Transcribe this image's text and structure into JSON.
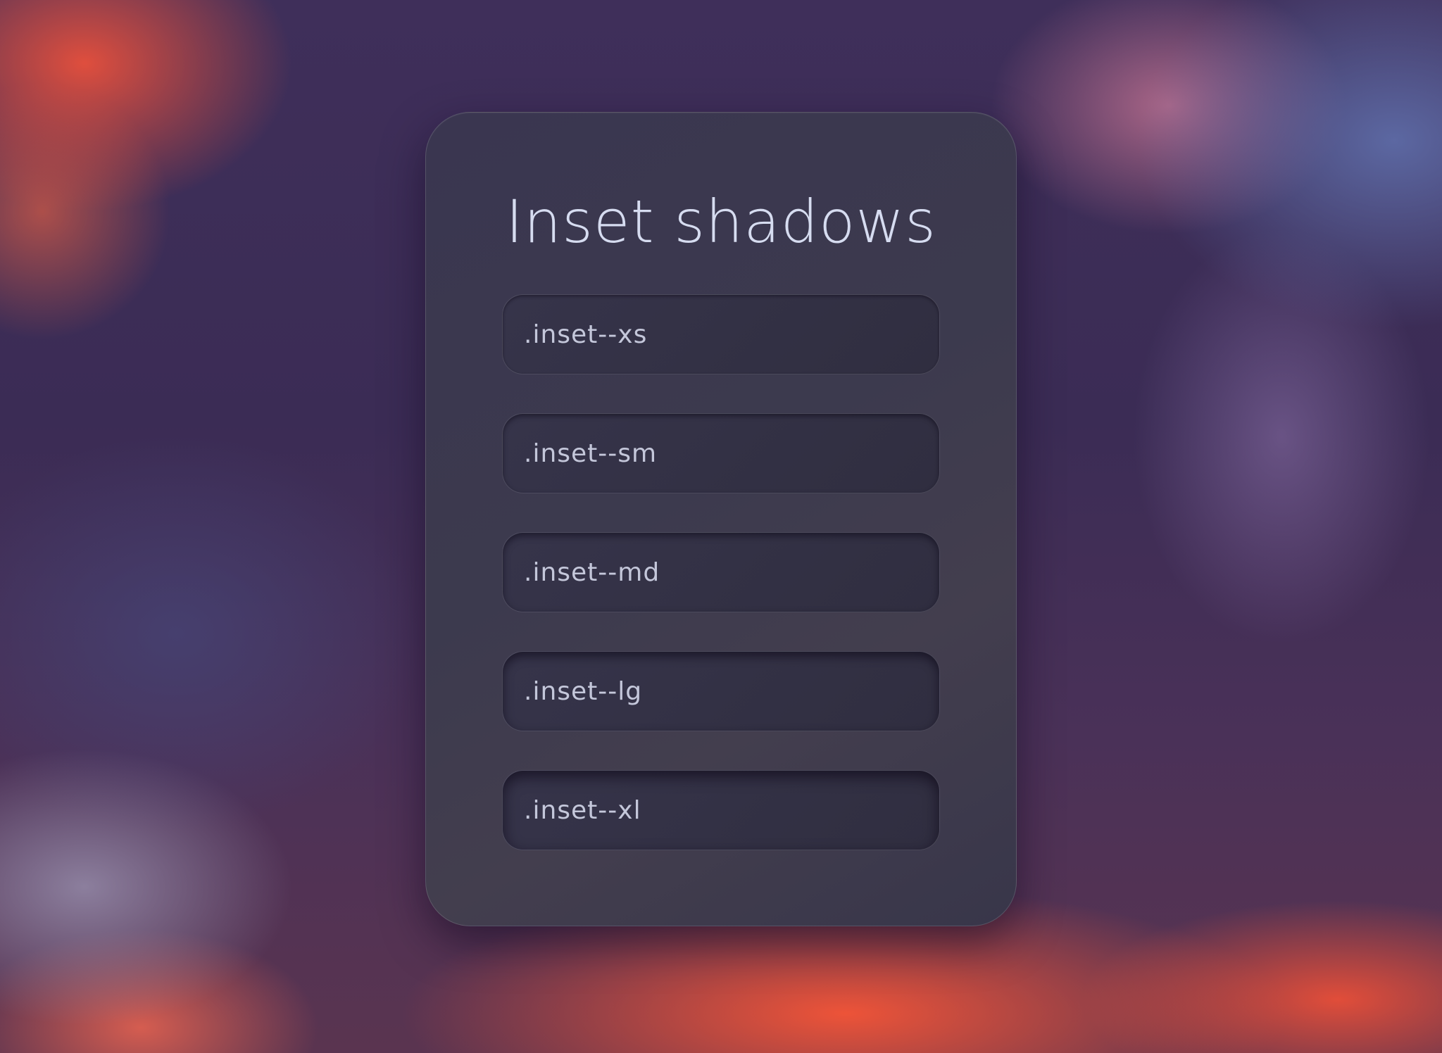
{
  "card": {
    "title": "Inset shadows",
    "items": [
      {
        "label": ".inset--xs"
      },
      {
        "label": ".inset--sm"
      },
      {
        "label": ".inset--md"
      },
      {
        "label": ".inset--lg"
      },
      {
        "label": ".inset--xl"
      }
    ]
  },
  "colors": {
    "card_background": "#3c3a4e",
    "title_text": "#d6dcf0",
    "item_text": "#c4c7da",
    "sky_accent": "#e8503c"
  }
}
